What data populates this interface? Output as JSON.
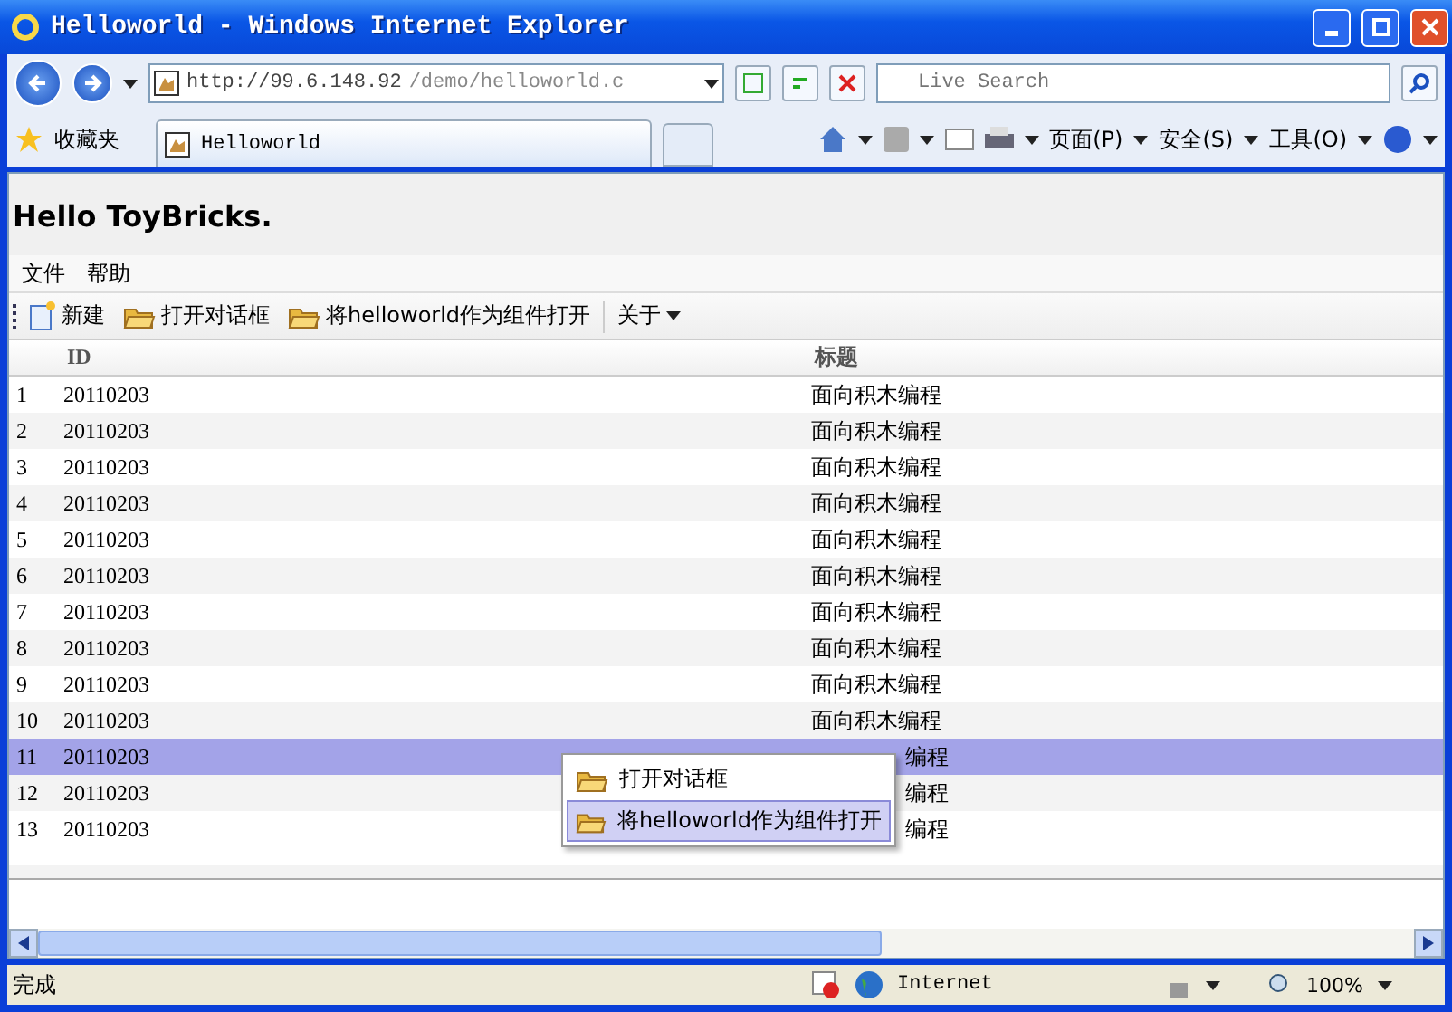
{
  "window": {
    "title": "Helloworld - Windows Internet Explorer"
  },
  "address": {
    "url_host": "http://99.6.148.92",
    "url_path": "/demo/helloworld.c"
  },
  "search": {
    "placeholder": "Live Search"
  },
  "favorites": {
    "label": "收藏夹"
  },
  "tabs": [
    {
      "label": "Helloworld",
      "selected": true
    }
  ],
  "command_bar": [
    {
      "label": "页面(P)"
    },
    {
      "label": "安全(S)"
    },
    {
      "label": "工具(O)"
    }
  ],
  "page": {
    "heading": "Hello ToyBricks.",
    "menu": [
      "文件",
      "帮助"
    ],
    "toolbar": [
      {
        "kind": "new",
        "label": "新建"
      },
      {
        "kind": "folder",
        "label": "打开对话框"
      },
      {
        "kind": "folder",
        "label": "将helloworld作为组件打开"
      },
      {
        "kind": "dropdown",
        "label": "关于"
      }
    ],
    "table": {
      "columns": [
        "ID",
        "标题"
      ],
      "rows": [
        {
          "num": "1",
          "id": "20110203",
          "title": "面向积木编程",
          "selected": false
        },
        {
          "num": "2",
          "id": "20110203",
          "title": "面向积木编程",
          "selected": false
        },
        {
          "num": "3",
          "id": "20110203",
          "title": "面向积木编程",
          "selected": false
        },
        {
          "num": "4",
          "id": "20110203",
          "title": "面向积木编程",
          "selected": false
        },
        {
          "num": "5",
          "id": "20110203",
          "title": "面向积木编程",
          "selected": false
        },
        {
          "num": "6",
          "id": "20110203",
          "title": "面向积木编程",
          "selected": false
        },
        {
          "num": "7",
          "id": "20110203",
          "title": "面向积木编程",
          "selected": false
        },
        {
          "num": "8",
          "id": "20110203",
          "title": "面向积木编程",
          "selected": false
        },
        {
          "num": "9",
          "id": "20110203",
          "title": "面向积木编程",
          "selected": false
        },
        {
          "num": "10",
          "id": "20110203",
          "title": "面向积木编程",
          "selected": false
        },
        {
          "num": "11",
          "id": "20110203",
          "title": "编程",
          "selected": true,
          "covered": true
        },
        {
          "num": "12",
          "id": "20110203",
          "title": "编程",
          "selected": false,
          "covered": true
        },
        {
          "num": "13",
          "id": "20110203",
          "title": "编程",
          "selected": false,
          "covered": true
        }
      ]
    },
    "context_menu": [
      {
        "label": "打开对话框",
        "selected": false
      },
      {
        "label": "将helloworld作为组件打开",
        "selected": true
      }
    ]
  },
  "status_bar": {
    "text": "完成",
    "zone": "Internet",
    "zoom": "100%"
  }
}
